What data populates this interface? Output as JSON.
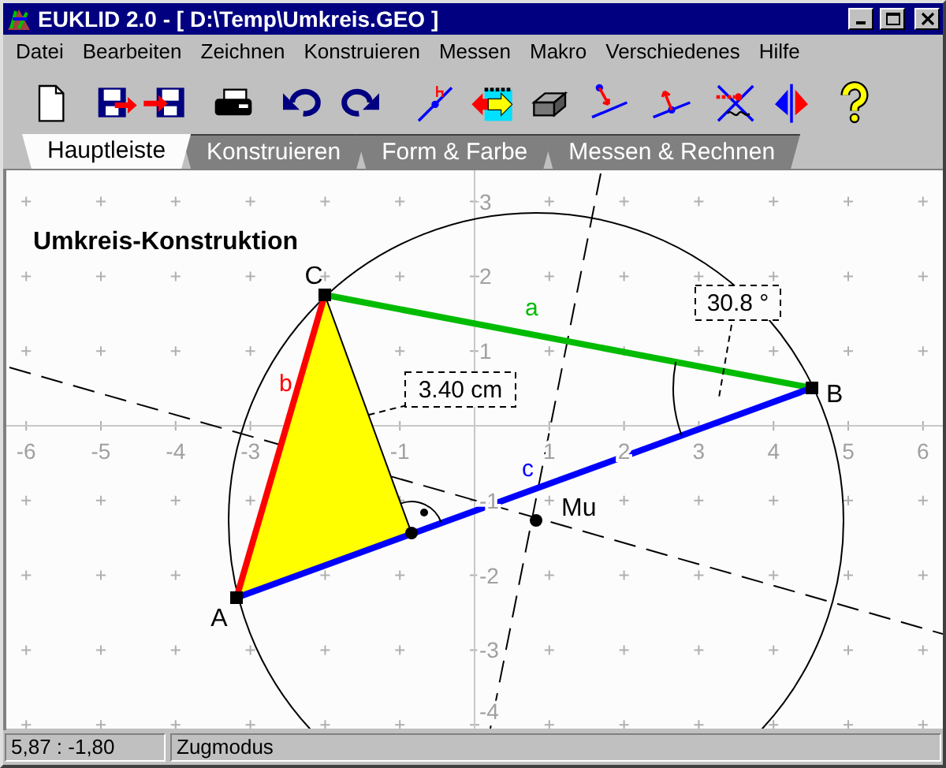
{
  "window": {
    "title": "EUKLID 2.0 - [ D:\\Temp\\Umkreis.GEO ]"
  },
  "menu": [
    {
      "label": "Datei"
    },
    {
      "label": "Bearbeiten"
    },
    {
      "label": "Zeichnen"
    },
    {
      "label": "Konstruieren"
    },
    {
      "label": "Messen"
    },
    {
      "label": "Makro"
    },
    {
      "label": "Verschiedenes"
    },
    {
      "label": "Hilfe"
    }
  ],
  "tabs": [
    {
      "label": "Hauptleiste",
      "selected": true
    },
    {
      "label": "Konstruieren",
      "selected": false
    },
    {
      "label": "Form & Farbe",
      "selected": false
    },
    {
      "label": "Messen & Rechnen",
      "selected": false
    }
  ],
  "canvas": {
    "title": "Umkreis-Konstruktion",
    "x_axis_labels": [
      "-6",
      "-5",
      "-4",
      "-3",
      "-1",
      "1",
      "2",
      "3",
      "4",
      "5",
      "6"
    ],
    "y_axis_labels": [
      "3",
      "2",
      "1",
      "-1",
      "-2",
      "-3",
      "-4"
    ],
    "points": [
      {
        "label": "C"
      },
      {
        "label": "B"
      },
      {
        "label": "A"
      },
      {
        "label": "Mu"
      }
    ],
    "segments": [
      {
        "label": "a",
        "color": "#00bb00"
      },
      {
        "label": "b",
        "color": "#ff0000"
      },
      {
        "label": "c",
        "color": "#0000ff"
      }
    ],
    "measurements": [
      "3.40 cm",
      "30.8 °"
    ]
  },
  "status_bar": [
    "5,87 : -1,80",
    "Zugmodus"
  ]
}
